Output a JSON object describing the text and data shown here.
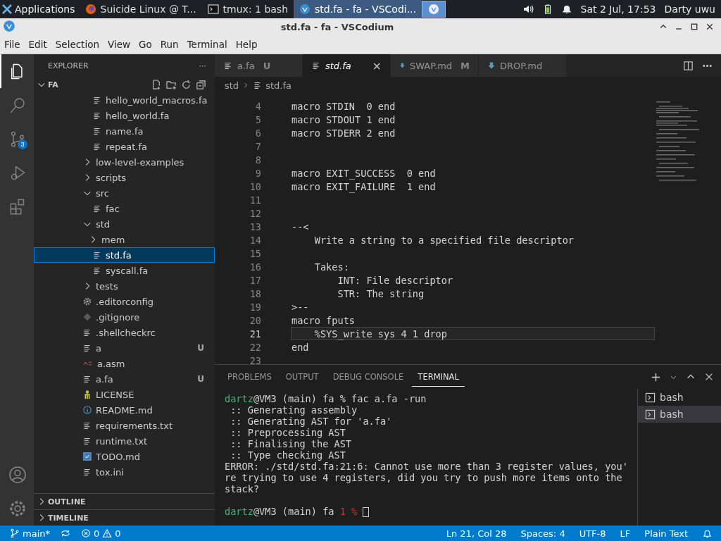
{
  "taskbar": {
    "apps_menu": {
      "label": "Applications"
    },
    "tasks": [
      {
        "kind": "browser",
        "label": "Suicide Linux @ T...",
        "selected": false
      },
      {
        "kind": "terminal",
        "label": "tmux: 1 bash",
        "selected": false
      },
      {
        "kind": "editor",
        "label": "std.fa - fa - VSCodi...",
        "selected": true
      },
      {
        "kind": "workspace",
        "selected": true
      }
    ],
    "clock": "Sat  2 Jul, 17:53",
    "user": "Darty uwu"
  },
  "window": {
    "title": "std.fa - fa - VSCodium"
  },
  "menu": [
    "File",
    "Edit",
    "Selection",
    "View",
    "Go",
    "Run",
    "Terminal",
    "Help"
  ],
  "activity_bar": {
    "items": [
      {
        "kind": "explorer",
        "selected": true
      },
      {
        "kind": "search",
        "selected": false
      },
      {
        "kind": "source-control",
        "selected": false,
        "badge": "3"
      },
      {
        "kind": "debug",
        "selected": false
      },
      {
        "kind": "extensions",
        "selected": false
      }
    ]
  },
  "sidebar": {
    "title": "EXPLORER",
    "more": "···",
    "root": {
      "label": "FA",
      "expanded": true
    },
    "tree": [
      {
        "kind": "partial",
        "children": [
          {
            "kind": "text",
            "label": "hello_world_macros.fa",
            "selected": false
          },
          {
            "kind": "text",
            "label": "hello_world.fa",
            "selected": false
          },
          {
            "kind": "text",
            "label": "name.fa",
            "selected": false
          },
          {
            "kind": "text",
            "label": "repeat.fa",
            "selected": false
          }
        ]
      },
      {
        "kind": "folder",
        "label": "low-level-examples",
        "expanded": false,
        "selected": false
      },
      {
        "kind": "folder",
        "label": "scripts",
        "expanded": false,
        "selected": false
      },
      {
        "kind": "folder",
        "label": "src",
        "expanded": true,
        "selected": false,
        "children": [
          {
            "kind": "text",
            "label": "fac",
            "selected": false
          }
        ]
      },
      {
        "kind": "folder",
        "label": "std",
        "expanded": true,
        "selected": false,
        "children": [
          {
            "kind": "folder",
            "label": "mem",
            "expanded": false,
            "selected": false
          },
          {
            "kind": "text",
            "label": "std.fa",
            "selected": true
          },
          {
            "kind": "text",
            "label": "syscall.fa",
            "selected": false
          }
        ]
      },
      {
        "kind": "folder",
        "label": "tests",
        "expanded": false,
        "selected": false
      },
      {
        "kind": "config",
        "label": ".editorconfig",
        "selected": false
      },
      {
        "kind": "ignore",
        "label": ".gitignore",
        "selected": false
      },
      {
        "kind": "text",
        "label": ".shellcheckrc",
        "selected": false
      },
      {
        "kind": "text",
        "label": "a",
        "selected": false,
        "git": "U"
      },
      {
        "kind": "asm",
        "label": "a.asm",
        "selected": false
      },
      {
        "kind": "text",
        "label": "a.fa",
        "selected": false,
        "git": "U"
      },
      {
        "kind": "license",
        "label": "LICENSE",
        "selected": false
      },
      {
        "kind": "readme",
        "label": "README.md",
        "selected": false
      },
      {
        "kind": "text",
        "label": "requirements.txt",
        "selected": false
      },
      {
        "kind": "text",
        "label": "runtime.txt",
        "selected": false
      },
      {
        "kind": "todo",
        "label": "TODO.md",
        "selected": false
      },
      {
        "kind": "text",
        "label": "tox.ini",
        "selected": false
      }
    ],
    "sections": [
      {
        "label": "OUTLINE",
        "expanded": false
      },
      {
        "label": "TIMELINE",
        "expanded": false
      }
    ]
  },
  "editor": {
    "tabs": [
      {
        "kind": "text",
        "label": "a.fa",
        "git": "U",
        "selected": false
      },
      {
        "kind": "text",
        "label": "std.fa",
        "close": "×",
        "selected": true
      },
      {
        "kind": "markdown",
        "label": "SWAP.md",
        "git": "M",
        "selected": false
      },
      {
        "kind": "markdown",
        "label": "DROP.md",
        "selected": false
      }
    ],
    "breadcrumb": [
      "std",
      "std.fa"
    ],
    "lines": [
      {
        "number": "4",
        "text": "macro STDIN  0 end",
        "current": false
      },
      {
        "number": "5",
        "text": "macro STDOUT 1 end",
        "current": false
      },
      {
        "number": "6",
        "text": "macro STDERR 2 end",
        "current": false
      },
      {
        "number": "7",
        "current": false
      },
      {
        "number": "8",
        "current": false
      },
      {
        "number": "9",
        "text": "macro EXIT_SUCCESS  0 end",
        "current": false
      },
      {
        "number": "10",
        "text": "macro EXIT_FAILURE  1 end",
        "current": false
      },
      {
        "number": "11",
        "current": false
      },
      {
        "number": "12",
        "current": false
      },
      {
        "number": "13",
        "text": "--<",
        "current": false
      },
      {
        "number": "14",
        "text": "    Write a string to a specified file descriptor",
        "current": false
      },
      {
        "number": "15",
        "current": false
      },
      {
        "number": "16",
        "text": "    Takes:",
        "current": false
      },
      {
        "number": "17",
        "text": "        INT: File descriptor",
        "current": false
      },
      {
        "number": "18",
        "text": "        STR: The string",
        "current": false
      },
      {
        "number": "19",
        "text": ">--",
        "current": false
      },
      {
        "number": "20",
        "text": "macro fputs",
        "current": false
      },
      {
        "number": "21",
        "text": "    %SYS_write sys 4 1 drop",
        "current": true
      },
      {
        "number": "22",
        "text": "end",
        "current": false
      },
      {
        "number": "23",
        "current": false
      }
    ]
  },
  "panel": {
    "tabs": [
      {
        "label": "PROBLEMS",
        "selected": false
      },
      {
        "label": "OUTPUT",
        "selected": false
      },
      {
        "label": "DEBUG CONSOLE",
        "selected": false
      },
      {
        "label": "TERMINAL",
        "selected": true
      }
    ],
    "terminal_lines": [
      [
        {
          "text": "dartz",
          "color": "#3fb37f"
        },
        {
          "text": "@VM3 (main) fa % fac a.fa -run",
          "color": "#d4d4d4"
        }
      ],
      [
        {
          "text": " :: Generating assembly",
          "color": "#d4d4d4"
        }
      ],
      [
        {
          "text": " :: Generating AST for 'a.fa'",
          "color": "#d4d4d4"
        }
      ],
      [
        {
          "text": " :: Preprocessing AST",
          "color": "#d4d4d4"
        }
      ],
      [
        {
          "text": " :: Finalising the AST",
          "color": "#d4d4d4"
        }
      ],
      [
        {
          "text": " :: Type checking AST",
          "color": "#d4d4d4"
        }
      ],
      [
        {
          "text": "ERROR: ./std/std.fa:21:6: Cannot use more than 3 register values, you'",
          "color": "#d4d4d4"
        }
      ],
      [
        {
          "text": "re trying to use 4 registers, did you try to push more items onto the",
          "color": "#d4d4d4"
        }
      ],
      [
        {
          "text": "stack?",
          "color": "#d4d4d4"
        }
      ],
      {
        "kind": "blank"
      },
      [
        {
          "text": "dartz",
          "color": "#3fb37f"
        },
        {
          "text": "@VM3 (main) fa ",
          "color": "#d4d4d4"
        },
        {
          "text": "1 %",
          "color": "#cd3131"
        }
      ]
    ],
    "terminals": [
      {
        "label": "bash",
        "selected": false
      },
      {
        "label": "bash",
        "selected": true
      }
    ]
  },
  "status_bar": {
    "branch": "main*",
    "errors": "0",
    "warnings": "0",
    "items": [
      "Ln 21, Col 28",
      "Spaces: 4",
      "UTF-8",
      "LF",
      "Plain Text"
    ]
  }
}
